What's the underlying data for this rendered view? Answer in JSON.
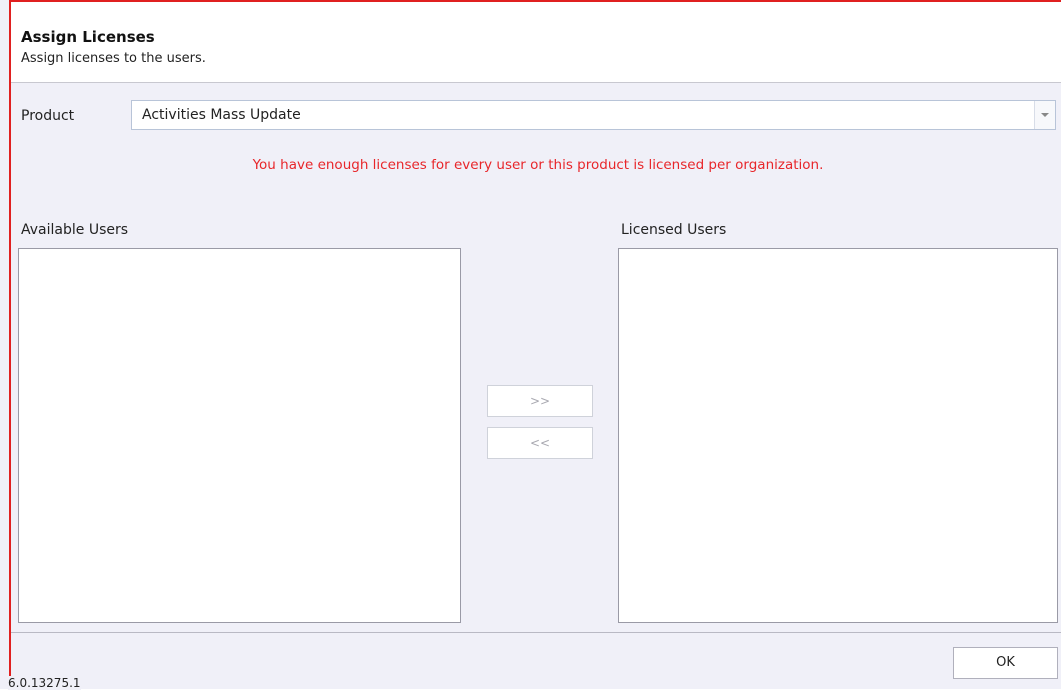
{
  "header": {
    "title": "Assign Licenses",
    "subtitle": "Assign licenses to the users."
  },
  "product": {
    "label": "Product",
    "selected": "Activities Mass Update"
  },
  "message": "You have enough licenses for every user or this product is licensed per organization.",
  "lists": {
    "available_label": "Available Users",
    "licensed_label": "Licensed Users",
    "available_items": [],
    "licensed_items": []
  },
  "buttons": {
    "add_label": ">>",
    "remove_label": "<<",
    "ok_label": "OK"
  },
  "version": "6.0.13275.1",
  "colors": {
    "message": "#e8262a",
    "frame_border": "#e02020",
    "background": "#f0f0f8"
  },
  "icons": {
    "dropdown": "chevron-down-icon"
  }
}
